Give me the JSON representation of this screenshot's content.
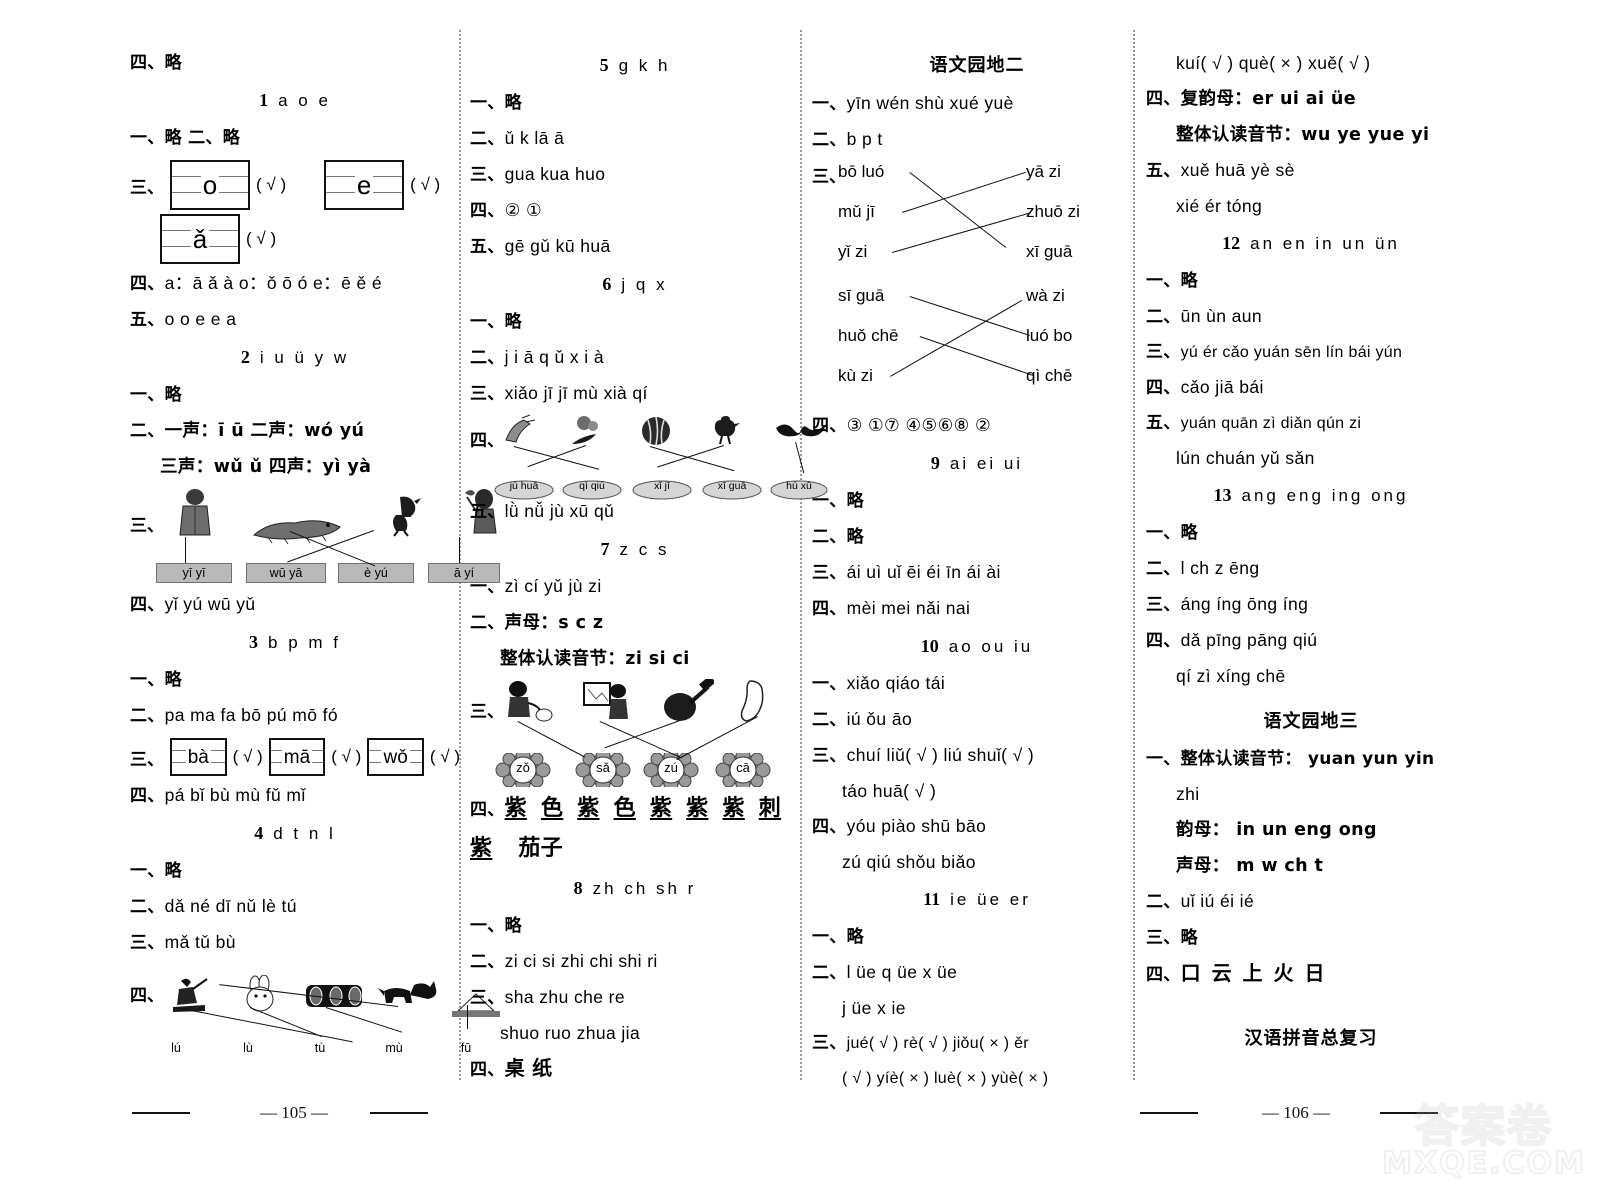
{
  "document": {
    "type": "answer-key",
    "left_page_number": "— 105 —",
    "right_page_number": "— 106 —",
    "watermark_top": "答案卷",
    "watermark_bottom": "MXQE.COM"
  },
  "columns": {
    "col1": {
      "top_line": "四、略",
      "lessons": [
        {
          "number": "1",
          "title": "a o e",
          "items": [
            {
              "label": "一、",
              "text": "略   二、略"
            },
            {
              "label": "三、",
              "type": "fourline-check",
              "boxes": [
                {
                  "letter": "o",
                  "mark": "( √ )"
                },
                {
                  "letter": "e",
                  "mark": "( √ )"
                },
                {
                  "letter": "ǎ",
                  "mark": "( √ )"
                }
              ]
            },
            {
              "label": "四、",
              "text": "a：ā ǎ à   o：ǒ ō ó   e：ē ě é"
            },
            {
              "label": "五、",
              "text": "o  o     e  e     a"
            }
          ]
        },
        {
          "number": "2",
          "title": "i u ü y w",
          "items": [
            {
              "label": "一、",
              "text": "略"
            },
            {
              "label": "二、",
              "text": "一声：ī  ū   二声：wó  yú"
            },
            {
              "label": "",
              "text": "三声：wǔ  ǔ   四声：yì  yà",
              "indent": true
            },
            {
              "label": "三、",
              "type": "picture-match",
              "pictures": [
                "person-in-coat",
                "crocodile",
                "bird",
                "girl-with-flower"
              ],
              "labels": [
                "yī yī",
                "wū yā",
                "è yú",
                "ā yí"
              ]
            },
            {
              "label": "四、",
              "text": "yǐ  yú  wū  yǔ"
            }
          ]
        },
        {
          "number": "3",
          "title": "b p m f",
          "items": [
            {
              "label": "一、",
              "text": "略"
            },
            {
              "label": "二、",
              "text": "pa  ma  fa      bō  pú  mō  fó"
            },
            {
              "label": "三、",
              "type": "box-check",
              "boxes": [
                {
                  "letter": "bà",
                  "mark": "( √ )"
                },
                {
                  "letter": "mā",
                  "mark": "( √ )"
                },
                {
                  "letter": "wǒ",
                  "mark": "( √ )"
                }
              ]
            },
            {
              "label": "四、",
              "text": "pá  bǐ  bù  mù  fǔ  mǐ"
            }
          ]
        },
        {
          "number": "4",
          "title": "d t n l",
          "items": [
            {
              "label": "一、",
              "text": "略"
            },
            {
              "label": "二、",
              "text": "dǎ  né  dī  nǔ  lè  tú"
            },
            {
              "label": "三、",
              "text": "mǎ  tǔ     bù"
            },
            {
              "label": "四、",
              "type": "picture-match",
              "pictures": [
                "person-hoeing",
                "rabbit",
                "log-pile",
                "donkey",
                "hut"
              ],
              "labels": [
                "lú",
                "lù",
                "tù",
                "mù",
                "fū"
              ]
            }
          ]
        }
      ]
    },
    "col2": {
      "lessons": [
        {
          "number": "5",
          "title": "g k h",
          "items": [
            {
              "label": "一、",
              "text": "略"
            },
            {
              "label": "二、",
              "text": "ǔ  k  lā  ā"
            },
            {
              "label": "三、",
              "text": "gua  kua  huo"
            },
            {
              "label": "四、",
              "text": "②  ①"
            },
            {
              "label": "五、",
              "text": "gē  gǔ  kū  huā"
            }
          ]
        },
        {
          "number": "6",
          "title": "j q x",
          "items": [
            {
              "label": "一、",
              "text": "略"
            },
            {
              "label": "二、",
              "text": "j  i  ā      q  ǔ      x  i  à"
            },
            {
              "label": "三、",
              "text": "xiǎo jī   jī mù   xià qí"
            },
            {
              "label": "四、",
              "type": "bubble-match",
              "pictures": [
                "hand-writing",
                "flower-bunch",
                "watermelon",
                "chick",
                "moustache"
              ],
              "labels": [
                "jù huā",
                "qì qiú",
                "xǐ jī",
                "xī guā",
                "hú xū"
              ]
            },
            {
              "label": "五、",
              "text": "lǜ  nǚ  jù  xū  qǔ"
            }
          ]
        },
        {
          "number": "7",
          "title": "z c s",
          "items": [
            {
              "label": "一、",
              "text": "zì  cí yǔ   jù zi"
            },
            {
              "label": "二、",
              "text": "声母：s  c  z"
            },
            {
              "label": "",
              "text": "整体认读音节：zi  si  ci",
              "indent": true
            },
            {
              "label": "三、",
              "type": "flower-match",
              "pictures": [
                "girl-writing",
                "boy-at-board",
                "stone-hammer",
                "foot"
              ],
              "labels": [
                "zǒ",
                "sǎ",
                "zú",
                "cā"
              ]
            },
            {
              "label": "四、",
              "type": "underlined",
              "chars": [
                "紫",
                "色",
                "紫",
                "色",
                "紫",
                "紫",
                "紫",
                "刺"
              ],
              "underline": [
                true,
                true,
                true,
                true,
                true,
                true,
                true,
                true
              ],
              "line2_chars": [
                "紫",
                "茄子"
              ],
              "line2_underline": [
                true,
                false
              ]
            }
          ]
        },
        {
          "number": "8",
          "title": "zh ch sh r",
          "items": [
            {
              "label": "一、",
              "text": "略"
            },
            {
              "label": "二、",
              "text": "zi  ci  si  zhi  chi  shi  ri"
            },
            {
              "label": "三、",
              "text": "sha  zhu  che  re"
            },
            {
              "label": "",
              "text": "shuo  ruo  zhua  jia",
              "indent": true
            },
            {
              "label": "四、",
              "text": "桌   纸"
            }
          ]
        }
      ]
    },
    "col3": {
      "unit_title": "语文园地二",
      "unit_items": [
        {
          "label": "一、",
          "text": "yīn  wén  shù  xué  yuè"
        },
        {
          "label": "二、",
          "text": "b   p   t"
        },
        {
          "label": "三、",
          "type": "word-match",
          "left": [
            "bō luó",
            "mǔ jī",
            "yǐ zi",
            "sī guā",
            "huǒ chē",
            "kù zi"
          ],
          "right": [
            "yā zi",
            "zhuō zi",
            "xī guā",
            "wà zi",
            "luó bo",
            "qì chē"
          ],
          "pairs": [
            [
              0,
              2
            ],
            [
              1,
              0
            ],
            [
              2,
              1
            ],
            [
              3,
              4
            ],
            [
              4,
              5
            ],
            [
              5,
              3
            ]
          ]
        },
        {
          "label": "四、",
          "text": "③  ①⑦  ④⑤⑥⑧  ②"
        }
      ],
      "lessons": [
        {
          "number": "9",
          "title": "ai ei ui",
          "items": [
            {
              "label": "一、",
              "text": "略"
            },
            {
              "label": "二、",
              "text": "略"
            },
            {
              "label": "三、",
              "text": "ái  uì  uǐ  ēi  éi  īn  ái  ài"
            },
            {
              "label": "四、",
              "text": "mèi  mei  nǎi  nai"
            }
          ]
        },
        {
          "number": "10",
          "title": "ao ou iu",
          "items": [
            {
              "label": "一、",
              "text": "xiǎo  qiáo  tái"
            },
            {
              "label": "二、",
              "text": "iú  ǒu  āo"
            },
            {
              "label": "三、",
              "text": "chuí liǔ( √ )   liú shuǐ( √ )"
            },
            {
              "label": "",
              "text": "táo huā( √ )",
              "indent": true
            },
            {
              "label": "四、",
              "text": "yóu piào  shū bāo"
            },
            {
              "label": "",
              "text": "zú qiú  shǒu biǎo",
              "indent": true
            }
          ]
        },
        {
          "number": "11",
          "title": "ie üe er",
          "items": [
            {
              "label": "一、",
              "text": "略"
            },
            {
              "label": "二、",
              "text": "l  üe     q  üe     x  üe"
            },
            {
              "label": "",
              "text": "j  üe     x  ie",
              "indent": true
            },
            {
              "label": "三、",
              "text": "jué( √ )   rè( √ )    jiǒu( × )   ěr"
            },
            {
              "label": "",
              "text": "( √ )   yíè( × )   luè( × )   yùè( × )",
              "indent": true
            }
          ]
        }
      ]
    },
    "col4": {
      "top_items": [
        {
          "label": "",
          "text": "kuí( √ )   què( × )   xuě( √ )",
          "indent": true
        },
        {
          "label": "四、",
          "text": "复韵母：er ui ai üe"
        },
        {
          "label": "",
          "text": "整体认读音节：wu ye yue yi",
          "indent": true
        },
        {
          "label": "五、",
          "text": "xuě huā   yè sè"
        },
        {
          "label": "",
          "text": "xié   ér tóng",
          "indent": true
        }
      ],
      "lessons": [
        {
          "number": "12",
          "title": "an en in un ün",
          "items": [
            {
              "label": "一、",
              "text": "略"
            },
            {
              "label": "二、",
              "text": "ūn  ùn  aun"
            },
            {
              "label": "三、",
              "text": "yú ér  cǎo yuán  sēn lín  bái yún"
            },
            {
              "label": "四、",
              "text": "cǎo  jiā  bái"
            },
            {
              "label": "五、",
              "text": "yuán quān  zì diǎn  qún zi"
            },
            {
              "label": "",
              "text": "lún chuán   yǔ sǎn",
              "indent": true
            }
          ]
        },
        {
          "number": "13",
          "title": "ang eng ing ong",
          "items": [
            {
              "label": "一、",
              "text": "略"
            },
            {
              "label": "二、",
              "text": "l  ch  z  ēng"
            },
            {
              "label": "三、",
              "text": "áng  íng  ōng  íng"
            },
            {
              "label": "四、",
              "text": "dǎ pīng pāng qiú"
            },
            {
              "label": "",
              "text": "qí zì xíng chē",
              "indent": true
            }
          ]
        }
      ],
      "unit_title": "语文园地三",
      "unit_items": [
        {
          "label": "一、",
          "text": "整体认读音节：  yuan   yun   yin"
        },
        {
          "label": "",
          "text": "zhi",
          "indent": true
        },
        {
          "label": "",
          "text": "韵母：  in  un  eng  ong",
          "indent": true
        },
        {
          "label": "",
          "text": "声母：  m  w  ch  t",
          "indent": true
        },
        {
          "label": "二、",
          "text": "uǐ   iú   éi   ié"
        },
        {
          "label": "三、",
          "text": "略"
        },
        {
          "label": "四、",
          "text": "口   云   上   火   日"
        }
      ],
      "footer_title": "汉语拼音总复习"
    }
  }
}
